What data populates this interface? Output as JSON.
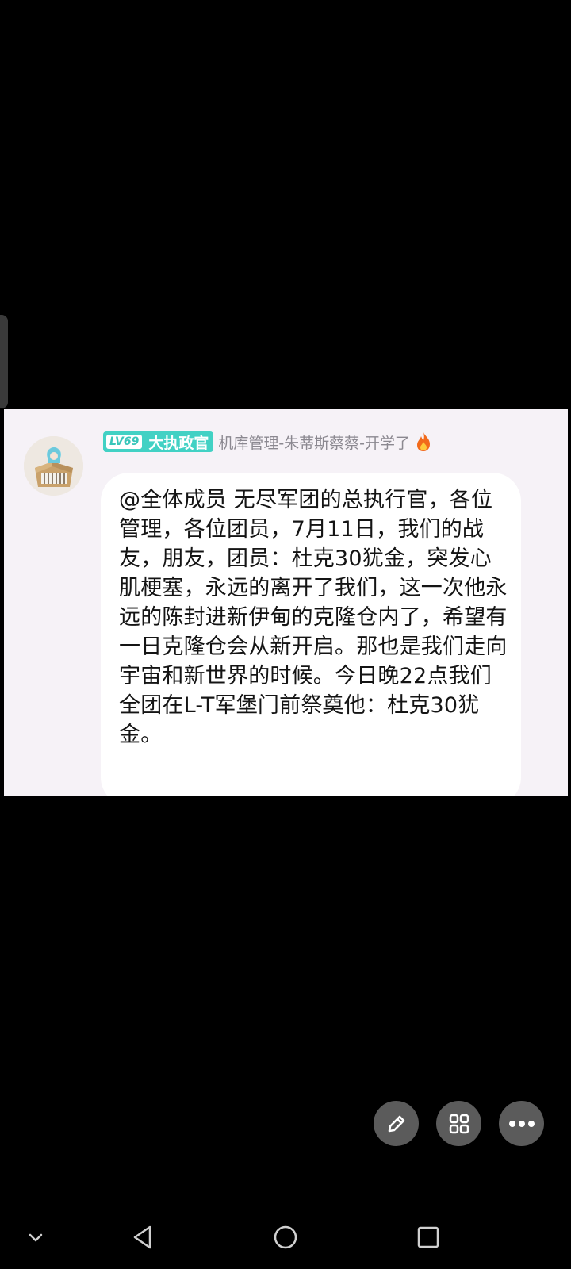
{
  "post": {
    "level_tag": "LV69",
    "title_badge": "大执政官",
    "nickname": "机库管理-朱蒂斯蔡蔡-开学了",
    "message": "@全体成员 无尽军团的总执行官，各位管理，各位团员，7月11日，我们的战友，朋友，团员：杜克30犹金，突发心肌梗塞，永远的离开了我们，这一次他永远的陈封进新伊甸的克隆仓内了，希望有一日克隆仓会从新开启。那也是我们走向宇宙和新世界的时候。今日晚22点我们全团在L-T军堡门前祭奠他：杜克30犹金。"
  },
  "icons": {
    "fire": "fire-icon",
    "edit": "pencil-icon",
    "apps": "grid-icon",
    "more": "more-dots-icon",
    "nav_collapse": "chevron-down-icon",
    "nav_back": "back-triangle-icon",
    "nav_home": "home-circle-icon",
    "nav_recents": "recents-square-icon"
  },
  "colors": {
    "background": "#000000",
    "card_background": "#f6f2f7",
    "bubble": "#ffffff",
    "level_badge": "#42d1c4",
    "nickname": "#8b8890",
    "fab": "#5b5b5b"
  }
}
